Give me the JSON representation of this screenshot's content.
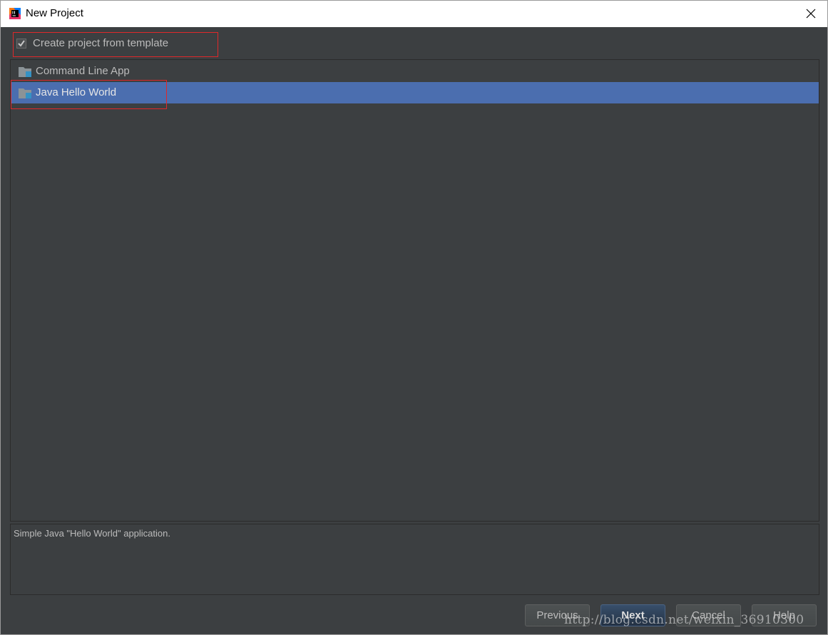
{
  "window": {
    "title": "New Project"
  },
  "template_option": {
    "label": "Create project from template",
    "checked": true
  },
  "templates": [
    {
      "label": "Command Line App",
      "selected": false
    },
    {
      "label": "Java Hello World",
      "selected": true
    }
  ],
  "description": "Simple Java \"Hello World\" application.",
  "buttons": {
    "previous": "Previous",
    "next": "Next",
    "cancel": "Cancel",
    "help": "Help"
  },
  "watermark": "http://blog.csdn.net/weixin_36910300",
  "colors": {
    "background": "#3c3f41",
    "selection": "#4b6eaf",
    "text": "#bbbbbb",
    "highlight_box": "#e0282a"
  }
}
